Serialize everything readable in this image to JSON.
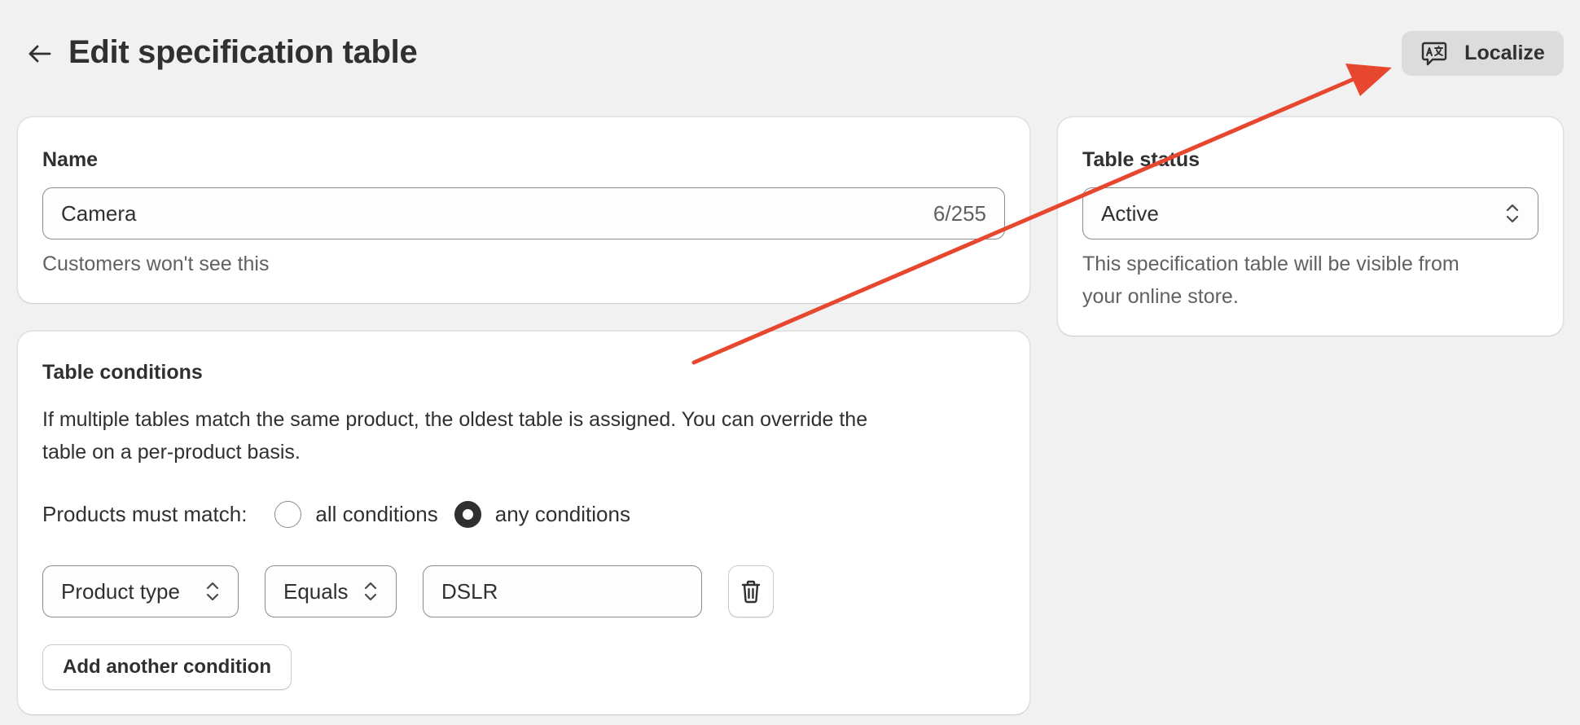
{
  "header": {
    "title": "Edit specification table",
    "back_icon": "arrow-left-icon",
    "localize_label": "Localize",
    "localize_icon": "translate-icon"
  },
  "name_card": {
    "heading": "Name",
    "value": "Camera",
    "counter": "6/255",
    "helper": "Customers won't see this"
  },
  "status_card": {
    "heading": "Table status",
    "selected": "Active",
    "helper_line1": "This specification table will be visible from",
    "helper_line2": "your online store."
  },
  "conditions_card": {
    "heading": "Table conditions",
    "description_line1": "If multiple tables match the same product, the oldest table is assigned. You can override the",
    "description_line2": "table on a per-product basis.",
    "match_label": "Products must match:",
    "options": [
      {
        "label": "all conditions",
        "checked": false
      },
      {
        "label": "any conditions",
        "checked": true
      }
    ],
    "condition": {
      "field": "Product type",
      "operator": "Equals",
      "value": "DSLR"
    },
    "add_label": "Add another condition"
  },
  "colors": {
    "background": "#f1f1f1",
    "annotation_arrow": "#e8472f",
    "text": "#303030",
    "muted_text": "#616161"
  }
}
